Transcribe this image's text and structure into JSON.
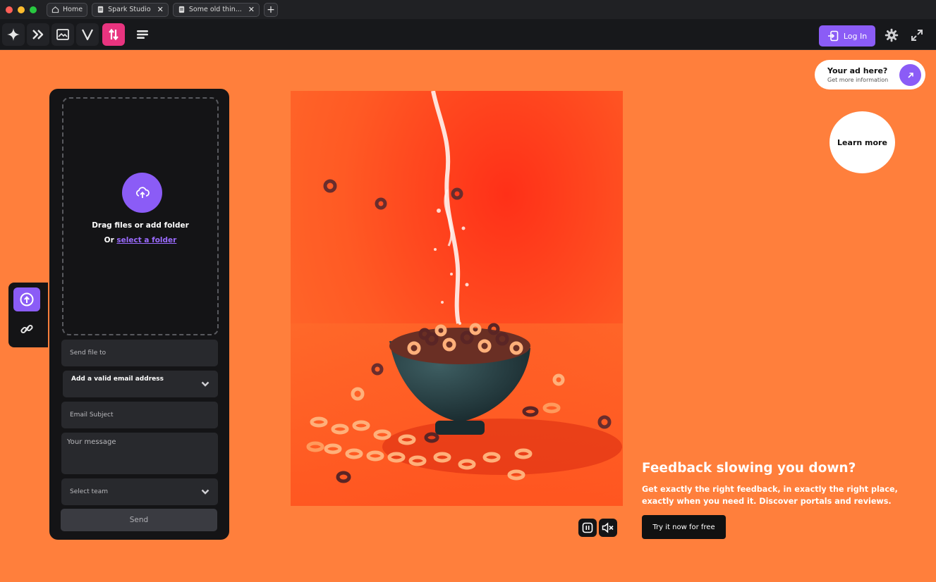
{
  "window": {
    "traffic_lights": [
      "#ff5f57",
      "#febc2e",
      "#28c840"
    ],
    "tabs": [
      {
        "label": "Home",
        "icon": "home-icon"
      },
      {
        "label": "Spark Studio",
        "icon": "document-icon",
        "closable": true
      },
      {
        "label": "Some old thin...",
        "icon": "document-icon",
        "closable": true
      }
    ],
    "new_tab": "+"
  },
  "toolbar": {
    "tools": [
      "sparkle-icon",
      "fast-forward-icon",
      "image-frame-icon",
      "v-logo-icon",
      "transfer-arrows-icon",
      "text-lines-icon"
    ],
    "active_tool": "transfer-arrows-icon",
    "login_label": "Log In",
    "right_icons": [
      "settings-icon",
      "fullscreen-icon"
    ]
  },
  "side_tabs": [
    {
      "icon": "upload-icon",
      "active": true
    },
    {
      "icon": "link-icon",
      "active": false
    }
  ],
  "upload": {
    "drop_title": "Drag files or add folder",
    "drop_or": "Or",
    "drop_link": "select a folder",
    "fields": {
      "send_to": "Send file to",
      "email": "Add a valid email address",
      "subject": "Email Subject",
      "message": "Your message",
      "team": "Select team"
    },
    "send_label": "Send"
  },
  "media": {
    "controls": [
      "pause-icon",
      "mute-icon"
    ]
  },
  "ad": {
    "title": "Your ad here?",
    "subtitle": "Get more information",
    "learn_more": "Learn more"
  },
  "promo": {
    "title": "Feedback slowing you down?",
    "body": "Get exactly the right feedback, in exactly the right place, exactly when you need it. Discover portals and reviews.",
    "cta": "Try it now for free"
  },
  "colors": {
    "background": "#ff7f3c",
    "accent": "#8b5cf6",
    "active_tool": "#e8347f"
  }
}
